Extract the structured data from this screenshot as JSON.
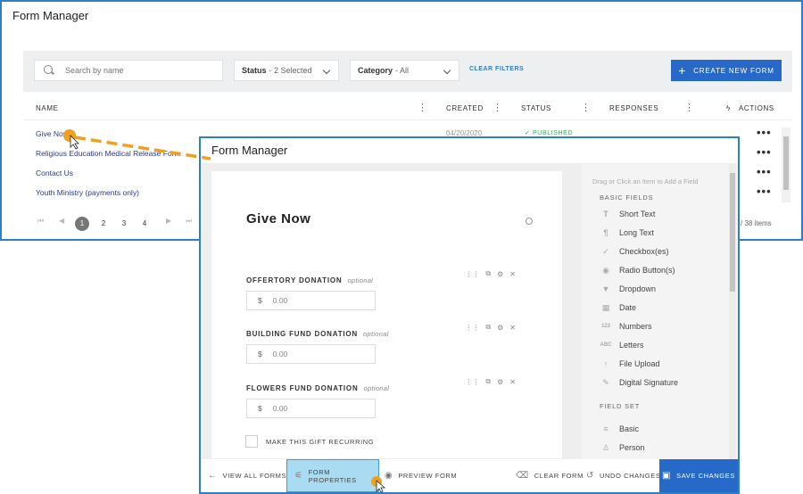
{
  "back": {
    "title": "Form Manager",
    "search_placeholder": "Search by name",
    "status_filter": {
      "label": "Status",
      "value": "- 2 Selected"
    },
    "category_filter": {
      "label": "Category",
      "value": "- All"
    },
    "clear_filters": "CLEAR FILTERS",
    "create_button": "CREATE NEW FORM",
    "columns": [
      "NAME",
      "CREATED",
      "STATUS",
      "RESPONSES",
      "ACTIONS"
    ],
    "rows": [
      {
        "name": "Give Now",
        "created": "04/20/2020",
        "status": "PUBLISHED"
      },
      {
        "name": "Religious Education Medical Release Form",
        "created": "",
        "status": ""
      },
      {
        "name": "Contact Us",
        "created": "",
        "status": ""
      },
      {
        "name": "Youth Ministry (payments only)",
        "created": "",
        "status": ""
      }
    ],
    "row_action": "•••",
    "pages": [
      "1",
      "2",
      "3",
      "4"
    ],
    "item_count": "/ 38 items"
  },
  "front": {
    "title": "Form Manager",
    "form_title": "Give Now",
    "fields": [
      {
        "label": "OFFERTORY DONATION",
        "optional": "optional",
        "currency": "$",
        "placeholder": "0.00"
      },
      {
        "label": "BUILDING FUND DONATION",
        "optional": "optional",
        "currency": "$",
        "placeholder": "0.00"
      },
      {
        "label": "FLOWERS FUND DONATION",
        "optional": "optional",
        "currency": "$",
        "placeholder": "0.00"
      }
    ],
    "recurring_label": "MAKE THIS GIFT RECURRING",
    "palette": {
      "hint": "Drag or Click an Item to Add a Field",
      "basic_header": "BASIC FIELDS",
      "basic_items": [
        {
          "label": "Short Text",
          "icon": "T"
        },
        {
          "label": "Long Text",
          "icon": "¶"
        },
        {
          "label": "Checkbox(es)",
          "icon": "✓"
        },
        {
          "label": "Radio Button(s)",
          "icon": "◉"
        },
        {
          "label": "Dropdown",
          "icon": "▼"
        },
        {
          "label": "Date",
          "icon": "▦"
        },
        {
          "label": "Numbers",
          "icon": "123"
        },
        {
          "label": "Letters",
          "icon": "ABC"
        },
        {
          "label": "File Upload",
          "icon": "↑"
        },
        {
          "label": "Digital Signature",
          "icon": "✎"
        }
      ],
      "fieldset_header": "FIELD SET",
      "fieldset_items": [
        {
          "label": "Basic",
          "icon": "≡"
        },
        {
          "label": "Person",
          "icon": "♙"
        }
      ]
    },
    "bottom": {
      "view_all": "VIEW ALL FORMS",
      "form_properties": "FORM PROPERTIES",
      "preview": "PREVIEW FORM",
      "clear": "CLEAR FORM",
      "undo": "UNDO CHANGES",
      "save": "SAVE CHANGES"
    }
  },
  "colors": {
    "accent": "#2769c9",
    "published": "#2fae5a",
    "link": "#2d3a8c",
    "arrow": "#f0a020",
    "highlight": "#a9dcf3"
  }
}
